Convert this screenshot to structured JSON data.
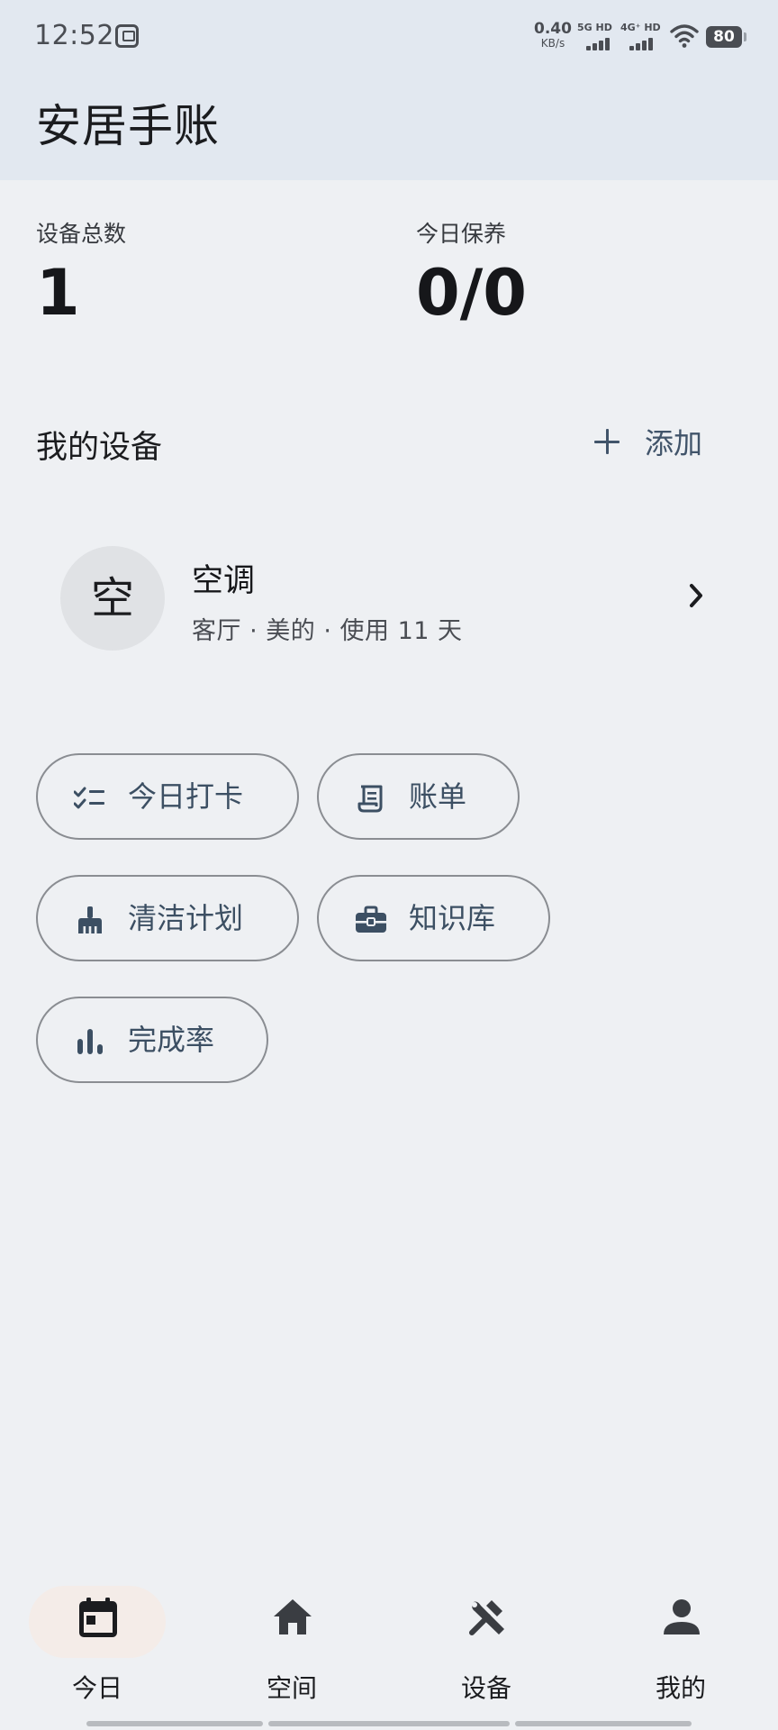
{
  "status_bar": {
    "time": "12:52",
    "net_speed_value": "0.40",
    "net_speed_unit": "KB/s",
    "signal_1_label": "5G HD",
    "signal_2_label": "4G⁺ HD",
    "battery": "80"
  },
  "header": {
    "title": "安居手账"
  },
  "stats": {
    "total_devices_label": "设备总数",
    "total_devices_value": "1",
    "today_maintenance_label": "今日保养",
    "today_maintenance_value": "0/0"
  },
  "my_devices": {
    "title": "我的设备",
    "add_label": "添加",
    "items": [
      {
        "avatar": "空",
        "name": "空调",
        "meta": "客厅 · 美的 · 使用 11 天"
      }
    ]
  },
  "shortcuts": {
    "checkin": "今日打卡",
    "bill": "账单",
    "cleaning": "清洁计划",
    "knowledge": "知识库",
    "completion": "完成率"
  },
  "bottom_nav": {
    "items": [
      {
        "label": "今日",
        "icon": "calendar-icon",
        "active": true
      },
      {
        "label": "空间",
        "icon": "home-icon",
        "active": false
      },
      {
        "label": "设备",
        "icon": "tools-icon",
        "active": false
      },
      {
        "label": "我的",
        "icon": "person-icon",
        "active": false
      }
    ]
  },
  "colors": {
    "background": "#eef0f3",
    "header_bg": "#e2e8f0",
    "accent": "#41546a",
    "active_nav_pill": "#f4ece8"
  }
}
